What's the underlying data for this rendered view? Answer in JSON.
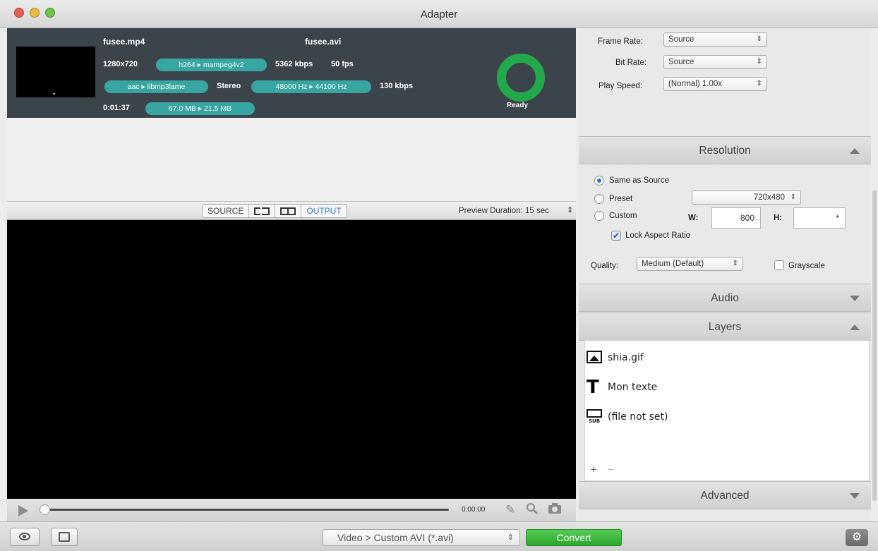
{
  "window": {
    "title": "Adapter"
  },
  "file": {
    "input_name": "fusee.mp4",
    "output_name": "fusee.avi",
    "resolution": "1280x720",
    "video_codec": "h264 ▸ mampeg4v2",
    "video_bitrate": "5362 kbps",
    "fps": "50 fps",
    "audio_codec": "aac ▸ libmp3lame",
    "channels": "Stereo",
    "sample_rate": "48000 Hz ▸ 44100 Hz",
    "audio_bitrate": "130 kbps",
    "duration": "0:01:37",
    "size": "67.0 MB ▸ 21.5 MB",
    "status": "Ready"
  },
  "preview": {
    "source_label": "SOURCE",
    "output_label": "OUTPUT",
    "duration_label": "Preview Duration: 15 sec",
    "stepper": "⇕"
  },
  "playback": {
    "timecode": "0:00:00",
    "progress": 0
  },
  "settings": {
    "frame_rate_label": "Frame Rate:",
    "frame_rate_value": "Source",
    "bit_rate_label": "Bit Rate:",
    "bit_rate_value": "Source",
    "play_speed_label": "Play Speed:",
    "play_speed_value": "(Normal) 1.00x"
  },
  "resolution": {
    "title": "Resolution",
    "same_as_source": "Same as Source",
    "preset_label": "Preset",
    "preset_value": "720x480",
    "custom_label": "Custom",
    "w_label": "W:",
    "w_value": "800",
    "h_label": "H:",
    "h_value": "*",
    "lock_aspect": "Lock Aspect Ratio",
    "quality_label": "Quality:",
    "quality_value": "Medium (Default)",
    "grayscale_label": "Grayscale"
  },
  "audio": {
    "title": "Audio"
  },
  "layers": {
    "title": "Layers",
    "items": [
      {
        "label": "shia.gif"
      },
      {
        "label": "Mon texte"
      },
      {
        "label": "(file not set)"
      }
    ],
    "sub_icon_text": "SUB",
    "add": "+",
    "remove": "−"
  },
  "advanced": {
    "title": "Advanced"
  },
  "bottom": {
    "format": "Video > Custom AVI (*.avi)",
    "convert": "Convert"
  },
  "colors": {
    "pill": "#37a6a2",
    "ready_ring": "#23a84b",
    "convert": "#3cb43c",
    "accent": "#2d6fd4"
  },
  "icons": {
    "select_arrows": "⇕",
    "gear": "⚙",
    "search": "🔍",
    "camera": "📷",
    "magic": "✎"
  }
}
